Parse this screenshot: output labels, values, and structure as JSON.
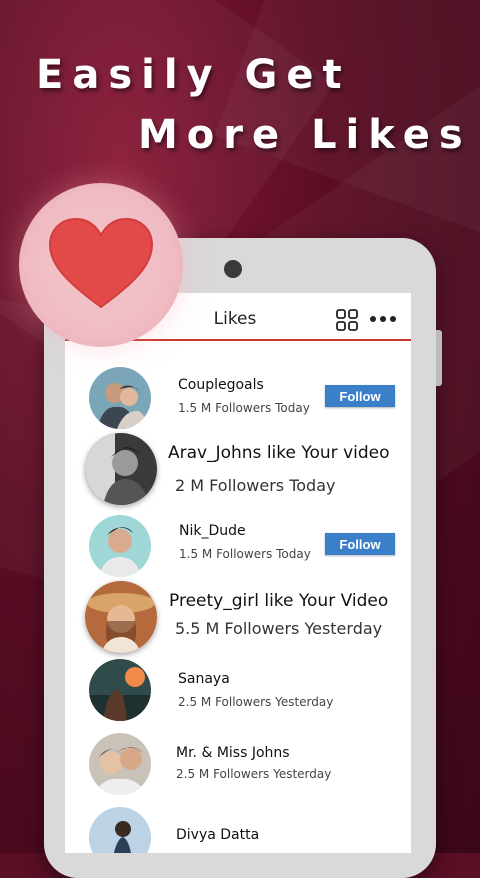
{
  "headline": {
    "line1": "Easily Get",
    "line2": "More Likes"
  },
  "app": {
    "title": "Likes",
    "icons": [
      "grid-icon",
      "more-icon",
      "heart-icon"
    ]
  },
  "list": [
    {
      "name": "Couplegoals",
      "sub": "1.5 M Followers Today",
      "button": "Follow"
    },
    {
      "name": "Arav_Johns like Your video",
      "sub": "2 M Followers Today"
    },
    {
      "name": "Nik_Dude",
      "sub": "1.5 M Followers Today",
      "button": "Follow"
    },
    {
      "name": "Preety_girl like Your Video",
      "sub": "5.5 M Followers Yesterday"
    },
    {
      "name": "Sanaya",
      "sub": "2.5 M Followers Yesterday"
    },
    {
      "name": "Mr. & Miss Johns",
      "sub": "2.5 M Followers Yesterday"
    },
    {
      "name": "Divya Datta",
      "sub": ""
    }
  ],
  "colors": {
    "accent_line": "#c9372c",
    "follow_button": "#3b7fc9",
    "heart": "#e24a4a",
    "background": "#5a0f25"
  }
}
